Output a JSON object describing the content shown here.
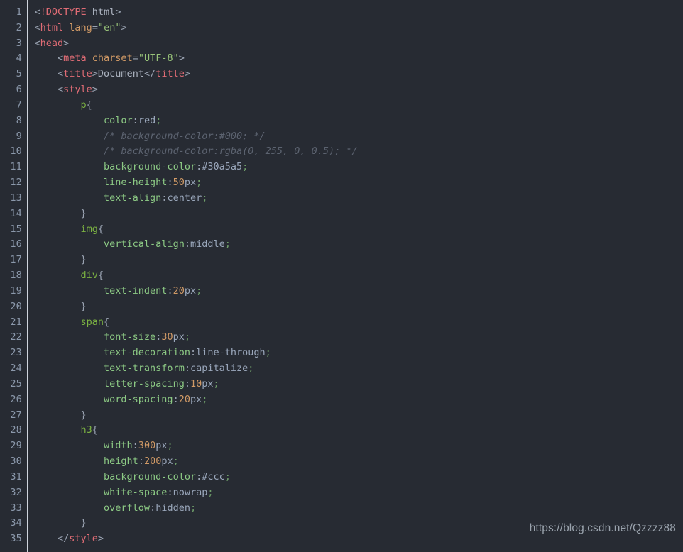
{
  "editor": {
    "language": "html",
    "theme_name": "one-dark",
    "background_color": "#272b33",
    "gutter_divider_color": "#cfd4dd",
    "line_number_color": "#8b98ab",
    "first_line": 1,
    "last_line": 35,
    "total_visible_lines": 35,
    "line_numbers": [
      "1",
      "2",
      "3",
      "4",
      "5",
      "6",
      "7",
      "8",
      "9",
      "10",
      "11",
      "12",
      "13",
      "14",
      "15",
      "16",
      "17",
      "18",
      "19",
      "20",
      "21",
      "22",
      "23",
      "24",
      "25",
      "26",
      "27",
      "28",
      "29",
      "30",
      "31",
      "32",
      "33",
      "34",
      "35"
    ],
    "palette": {
      "tag": "#e06c75",
      "attribute": "#d19a66",
      "string": "#98c379",
      "selector": "#7cb342",
      "property": "#8cc984",
      "value": "#9aa7bb",
      "number": "#d19a66",
      "comment": "#5c6370",
      "punctuation": "#9aa3b2",
      "plain_text": "#abb2bf"
    },
    "lines": [
      {
        "n": "1",
        "tokens": [
          {
            "c": "t-punct",
            "s": "<"
          },
          {
            "c": "t-tag",
            "s": "!DOCTYPE"
          },
          {
            "c": "t-text",
            "s": " html"
          },
          {
            "c": "t-punct",
            "s": ">"
          }
        ]
      },
      {
        "n": "2",
        "tokens": [
          {
            "c": "t-punct",
            "s": "<"
          },
          {
            "c": "t-tag",
            "s": "html"
          },
          {
            "c": "t-text",
            "s": " "
          },
          {
            "c": "t-attr",
            "s": "lang"
          },
          {
            "c": "t-punct",
            "s": "="
          },
          {
            "c": "t-string",
            "s": "\"en\""
          },
          {
            "c": "t-punct",
            "s": ">"
          }
        ]
      },
      {
        "n": "3",
        "tokens": [
          {
            "c": "t-punct",
            "s": "<"
          },
          {
            "c": "t-tag",
            "s": "head"
          },
          {
            "c": "t-punct",
            "s": ">"
          }
        ]
      },
      {
        "n": "4",
        "tokens": [
          {
            "c": "t-punct",
            "s": "    <"
          },
          {
            "c": "t-tag",
            "s": "meta"
          },
          {
            "c": "t-text",
            "s": " "
          },
          {
            "c": "t-attr",
            "s": "charset"
          },
          {
            "c": "t-punct",
            "s": "="
          },
          {
            "c": "t-string",
            "s": "\"UTF-8\""
          },
          {
            "c": "t-punct",
            "s": ">"
          }
        ]
      },
      {
        "n": "5",
        "tokens": [
          {
            "c": "t-punct",
            "s": "    <"
          },
          {
            "c": "t-tag",
            "s": "title"
          },
          {
            "c": "t-punct",
            "s": ">"
          },
          {
            "c": "t-text",
            "s": "Document"
          },
          {
            "c": "t-punct",
            "s": "</"
          },
          {
            "c": "t-tag",
            "s": "title"
          },
          {
            "c": "t-punct",
            "s": ">"
          }
        ]
      },
      {
        "n": "6",
        "tokens": [
          {
            "c": "t-punct",
            "s": "    <"
          },
          {
            "c": "t-tag",
            "s": "style"
          },
          {
            "c": "t-punct",
            "s": ">"
          }
        ]
      },
      {
        "n": "7",
        "tokens": [
          {
            "c": "t-selector",
            "s": "        p"
          },
          {
            "c": "t-punct",
            "s": "{"
          }
        ]
      },
      {
        "n": "8",
        "tokens": [
          {
            "c": "t-prop",
            "s": "            color"
          },
          {
            "c": "t-punct",
            "s": ":"
          },
          {
            "c": "t-value",
            "s": "red"
          },
          {
            "c": "t-semi",
            "s": ";"
          }
        ]
      },
      {
        "n": "9",
        "tokens": [
          {
            "c": "t-comment",
            "s": "            /* background-color:#000; */"
          }
        ]
      },
      {
        "n": "10",
        "tokens": [
          {
            "c": "t-comment",
            "s": "            /* background-color:rgba(0, 255, 0, 0.5); */"
          }
        ]
      },
      {
        "n": "11",
        "tokens": [
          {
            "c": "t-prop",
            "s": "            background-color"
          },
          {
            "c": "t-punct",
            "s": ":"
          },
          {
            "c": "t-value",
            "s": "#30a5a5"
          },
          {
            "c": "t-semi",
            "s": ";"
          }
        ]
      },
      {
        "n": "12",
        "tokens": [
          {
            "c": "t-prop",
            "s": "            line-height"
          },
          {
            "c": "t-punct",
            "s": ":"
          },
          {
            "c": "t-number",
            "s": "50"
          },
          {
            "c": "t-value",
            "s": "px"
          },
          {
            "c": "t-semi",
            "s": ";"
          }
        ]
      },
      {
        "n": "13",
        "tokens": [
          {
            "c": "t-prop",
            "s": "            text-align"
          },
          {
            "c": "t-punct",
            "s": ":"
          },
          {
            "c": "t-value",
            "s": "center"
          },
          {
            "c": "t-semi",
            "s": ";"
          }
        ]
      },
      {
        "n": "14",
        "tokens": [
          {
            "c": "t-punct",
            "s": "        }"
          }
        ]
      },
      {
        "n": "15",
        "tokens": [
          {
            "c": "t-selector",
            "s": "        img"
          },
          {
            "c": "t-punct",
            "s": "{"
          }
        ]
      },
      {
        "n": "16",
        "tokens": [
          {
            "c": "t-prop",
            "s": "            vertical-align"
          },
          {
            "c": "t-punct",
            "s": ":"
          },
          {
            "c": "t-value",
            "s": "middle"
          },
          {
            "c": "t-semi",
            "s": ";"
          }
        ]
      },
      {
        "n": "17",
        "tokens": [
          {
            "c": "t-punct",
            "s": "        }"
          }
        ]
      },
      {
        "n": "18",
        "tokens": [
          {
            "c": "t-selector",
            "s": "        div"
          },
          {
            "c": "t-punct",
            "s": "{"
          }
        ]
      },
      {
        "n": "19",
        "tokens": [
          {
            "c": "t-prop",
            "s": "            text-indent"
          },
          {
            "c": "t-punct",
            "s": ":"
          },
          {
            "c": "t-number",
            "s": "20"
          },
          {
            "c": "t-value",
            "s": "px"
          },
          {
            "c": "t-semi",
            "s": ";"
          }
        ]
      },
      {
        "n": "20",
        "tokens": [
          {
            "c": "t-punct",
            "s": "        }"
          }
        ]
      },
      {
        "n": "21",
        "tokens": [
          {
            "c": "t-selector",
            "s": "        span"
          },
          {
            "c": "t-punct",
            "s": "{"
          }
        ]
      },
      {
        "n": "22",
        "tokens": [
          {
            "c": "t-prop",
            "s": "            font-size"
          },
          {
            "c": "t-punct",
            "s": ":"
          },
          {
            "c": "t-number",
            "s": "30"
          },
          {
            "c": "t-value",
            "s": "px"
          },
          {
            "c": "t-semi",
            "s": ";"
          }
        ]
      },
      {
        "n": "23",
        "tokens": [
          {
            "c": "t-prop",
            "s": "            text-decoration"
          },
          {
            "c": "t-punct",
            "s": ":"
          },
          {
            "c": "t-value",
            "s": "line-through"
          },
          {
            "c": "t-semi",
            "s": ";"
          }
        ]
      },
      {
        "n": "24",
        "tokens": [
          {
            "c": "t-prop",
            "s": "            text-transform"
          },
          {
            "c": "t-punct",
            "s": ":"
          },
          {
            "c": "t-value",
            "s": "capitalize"
          },
          {
            "c": "t-semi",
            "s": ";"
          }
        ]
      },
      {
        "n": "25",
        "tokens": [
          {
            "c": "t-prop",
            "s": "            letter-spacing"
          },
          {
            "c": "t-punct",
            "s": ":"
          },
          {
            "c": "t-number",
            "s": "10"
          },
          {
            "c": "t-value",
            "s": "px"
          },
          {
            "c": "t-semi",
            "s": ";"
          }
        ]
      },
      {
        "n": "26",
        "tokens": [
          {
            "c": "t-prop",
            "s": "            word-spacing"
          },
          {
            "c": "t-punct",
            "s": ":"
          },
          {
            "c": "t-number",
            "s": "20"
          },
          {
            "c": "t-value",
            "s": "px"
          },
          {
            "c": "t-semi",
            "s": ";"
          }
        ]
      },
      {
        "n": "27",
        "tokens": [
          {
            "c": "t-punct",
            "s": "        }"
          }
        ]
      },
      {
        "n": "28",
        "tokens": [
          {
            "c": "t-selector",
            "s": "        h3"
          },
          {
            "c": "t-punct",
            "s": "{"
          }
        ]
      },
      {
        "n": "29",
        "tokens": [
          {
            "c": "t-prop",
            "s": "            width"
          },
          {
            "c": "t-punct",
            "s": ":"
          },
          {
            "c": "t-number",
            "s": "300"
          },
          {
            "c": "t-value",
            "s": "px"
          },
          {
            "c": "t-semi",
            "s": ";"
          }
        ]
      },
      {
        "n": "30",
        "tokens": [
          {
            "c": "t-prop",
            "s": "            height"
          },
          {
            "c": "t-punct",
            "s": ":"
          },
          {
            "c": "t-number",
            "s": "200"
          },
          {
            "c": "t-value",
            "s": "px"
          },
          {
            "c": "t-semi",
            "s": ";"
          }
        ]
      },
      {
        "n": "31",
        "tokens": [
          {
            "c": "t-prop",
            "s": "            background-color"
          },
          {
            "c": "t-punct",
            "s": ":"
          },
          {
            "c": "t-value",
            "s": "#ccc"
          },
          {
            "c": "t-semi",
            "s": ";"
          }
        ]
      },
      {
        "n": "32",
        "tokens": [
          {
            "c": "t-prop",
            "s": "            white-space"
          },
          {
            "c": "t-punct",
            "s": ":"
          },
          {
            "c": "t-value",
            "s": "nowrap"
          },
          {
            "c": "t-semi",
            "s": ";"
          }
        ]
      },
      {
        "n": "33",
        "tokens": [
          {
            "c": "t-prop",
            "s": "            overflow"
          },
          {
            "c": "t-punct",
            "s": ":"
          },
          {
            "c": "t-value",
            "s": "hidden"
          },
          {
            "c": "t-semi",
            "s": ";"
          }
        ]
      },
      {
        "n": "34",
        "tokens": [
          {
            "c": "t-punct",
            "s": "        }"
          }
        ]
      },
      {
        "n": "35",
        "tokens": [
          {
            "c": "t-punct",
            "s": "    </"
          },
          {
            "c": "t-tag",
            "s": "style"
          },
          {
            "c": "t-punct",
            "s": ">"
          }
        ]
      }
    ]
  },
  "watermark": {
    "text": "https://blog.csdn.net/Qzzzz88",
    "color": "#9aa3ad"
  }
}
